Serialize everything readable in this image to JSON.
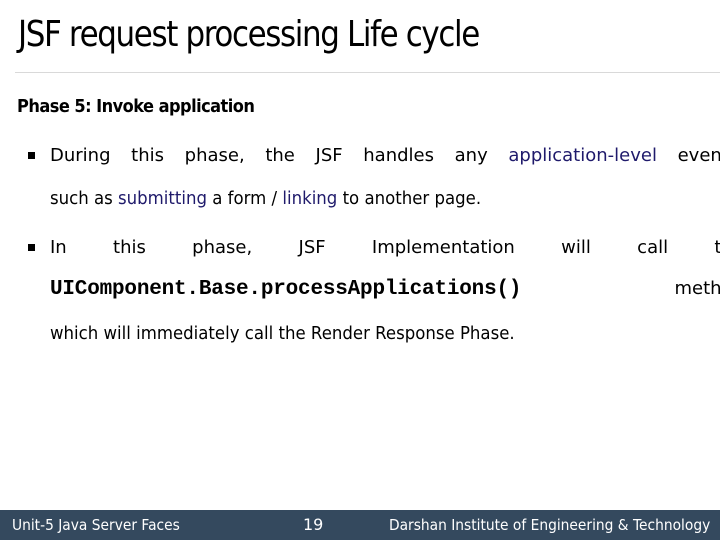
{
  "slide": {
    "title": "JSF request processing Life cycle",
    "subtitle": "Phase 5: Invoke application",
    "bullets": [
      {
        "line1": {
          "words": [
            "During",
            "this",
            "phase,",
            "the",
            "JSF",
            "handles",
            "any"
          ],
          "highlight": "application-level",
          "end": "events,"
        },
        "line2": {
          "part1": "such as ",
          "highlight1": "submitting",
          "part2": " a form / ",
          "highlight2": "linking",
          "part3": " to another page."
        }
      },
      {
        "line1": {
          "words": [
            "In",
            "this",
            "phase,",
            "JSF",
            "Implementation",
            "will",
            "call",
            "the"
          ]
        },
        "line2": {
          "code": "UIComponent.Base.processApplications()",
          "end": "method"
        },
        "line3": "which will immediately call the Render Response Phase."
      }
    ]
  },
  "footer": {
    "unit": "Unit-5 Java Server Faces",
    "page_number": "19",
    "institute": "Darshan Institute of Engineering & Technology"
  },
  "colors": {
    "highlight": "#1f1a6b",
    "footer_bg": "#34495e",
    "rule": "#d9d9d9"
  }
}
